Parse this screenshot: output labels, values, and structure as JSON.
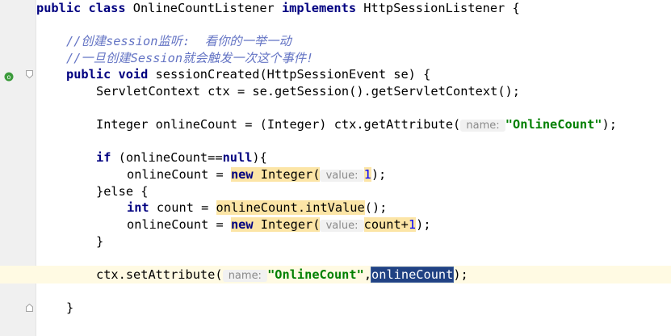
{
  "editor": {
    "lines": {
      "l1": [
        "public",
        " ",
        "class",
        " OnlineCountListener ",
        "implements",
        " HttpSessionListener {"
      ],
      "l2": [
        "//创建session监听:  看你的一举一动"
      ],
      "l3": [
        "//一旦创建Session就会触发一次这个事件!"
      ],
      "l4": [
        "public",
        " ",
        "void",
        " sessionCreated(HttpSessionEvent se) {"
      ],
      "l5": [
        "ServletContext ctx = se.getSession().getServletContext();"
      ],
      "l6": [
        "Integer onlineCount = (Integer) ctx.getAttribute(",
        " name: ",
        "\"OnlineCount\"",
        ");"
      ],
      "l7": [
        "if",
        " (onlineCount==",
        "null",
        "){"
      ],
      "l8": [
        "onlineCount = ",
        "new",
        " Integer(",
        " value: ",
        "1",
        ");"
      ],
      "l9": [
        "}else {"
      ],
      "l10": [
        "int",
        " count = ",
        "onlineCount.intValue",
        "();"
      ],
      "l11": [
        "onlineCount = ",
        "new",
        " Integer(",
        " value: ",
        "count+",
        "1",
        ");"
      ],
      "l12": [
        "}"
      ],
      "l13": [
        "ctx.setAttribute(",
        " name: ",
        "\"OnlineCount\"",
        ",",
        "onlineCount",
        ");"
      ],
      "l14": [
        "}"
      ]
    }
  },
  "colors": {
    "keyword": "#000080",
    "comment": "#6474c4",
    "string": "#008000",
    "number": "#0000ff",
    "hint": "#8a8a8a",
    "selection": "#214283",
    "current_line": "#fffae3",
    "usage_highlight": "#fce5a6"
  },
  "gutter": {
    "icons": [
      "run-override-icon",
      "fold-icon"
    ]
  }
}
